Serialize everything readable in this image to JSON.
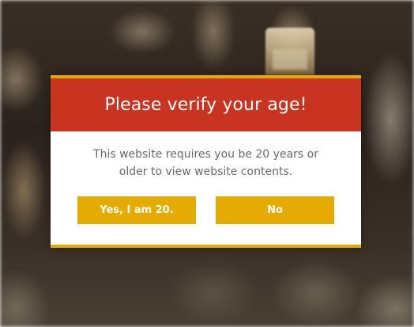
{
  "age_gate": {
    "title": "Please verify your age!",
    "message": "This website requires you be 20 years or older to view website contents.",
    "yes_label": "Yes, I am 20.",
    "no_label": "No"
  },
  "colors": {
    "header": "#c93421",
    "accent": "#e5ab00",
    "body_bg": "#ffffff",
    "message_text": "#6a6a6a"
  }
}
